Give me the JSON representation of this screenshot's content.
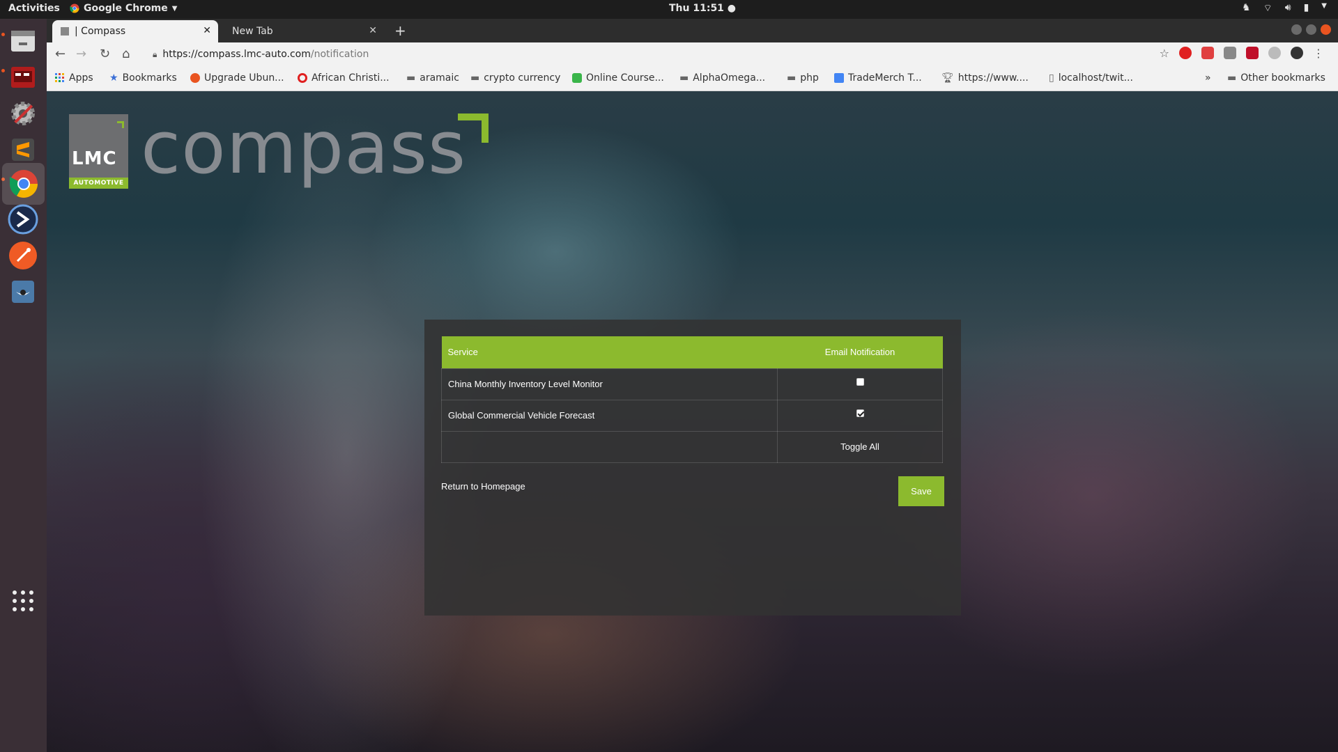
{
  "top_panel": {
    "activities": "Activities",
    "app_name": "Google Chrome",
    "clock": "Thu 11:51 ●"
  },
  "dock": {
    "items": [
      "files-icon",
      "presentation-icon",
      "settings-icon",
      "sublime-text-icon",
      "chrome-icon",
      "blue-app-icon",
      "postman-icon",
      "tagger-icon",
      "app-grid-icon"
    ]
  },
  "browser": {
    "tabs": [
      {
        "title": "| Compass",
        "active": true
      },
      {
        "title": "New Tab",
        "active": false
      }
    ],
    "url_host": "https://compass.lmc-auto.com",
    "url_path": "/notification",
    "bookmarks": [
      "Apps",
      "Bookmarks",
      "Upgrade Ubun...",
      "African Christi...",
      "aramaic",
      "crypto currency",
      "Online Course...",
      "AlphaOmega...",
      "php",
      "TradeMerch T...",
      "https://www....",
      "localhost/twit...",
      "»",
      "Other bookmarks"
    ]
  },
  "page": {
    "logo_lmc": "LMC",
    "logo_automotive": "AUTOMOTIVE",
    "brand_word": "compass",
    "table": {
      "headers": [
        "Service",
        "Email Notification"
      ],
      "rows": [
        {
          "service": "China Monthly Inventory Level Monitor",
          "checked": false
        },
        {
          "service": "Global Commercial Vehicle Forecast",
          "checked": true
        }
      ],
      "toggle_all": "Toggle All"
    },
    "return_link": "Return to Homepage",
    "save_label": "Save"
  },
  "colors": {
    "accent_green": "#8cba2e",
    "ubuntu_orange": "#e95420"
  }
}
